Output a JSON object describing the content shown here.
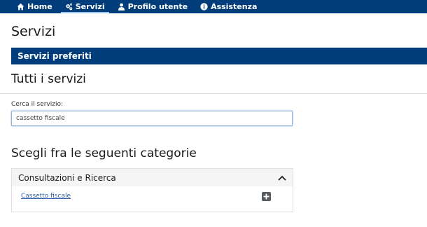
{
  "nav": {
    "items": [
      {
        "label": "Home",
        "icon": "home-icon"
      },
      {
        "label": "Servizi",
        "icon": "gears-icon"
      },
      {
        "label": "Profilo utente",
        "icon": "user-icon"
      },
      {
        "label": "Assistenza",
        "icon": "info-icon"
      }
    ],
    "active": "Servizi"
  },
  "page": {
    "title": "Servizi",
    "favorites_label": "Servizi preferiti",
    "all_services_title": "Tutti i servizi"
  },
  "search": {
    "label": "Cerca il servizio:",
    "value": "cassetto fiscale"
  },
  "categories": {
    "title": "Scegli fra le seguenti categorie",
    "items": [
      {
        "label": "Consultazioni e Ricerca",
        "expanded": true,
        "links": [
          {
            "label": "Cassetto fiscale",
            "action_icon": "plus-square-icon"
          }
        ]
      }
    ]
  },
  "colors": {
    "brand": "#003d7a",
    "link": "#2c5fa8",
    "add_button": "#555a5f"
  }
}
